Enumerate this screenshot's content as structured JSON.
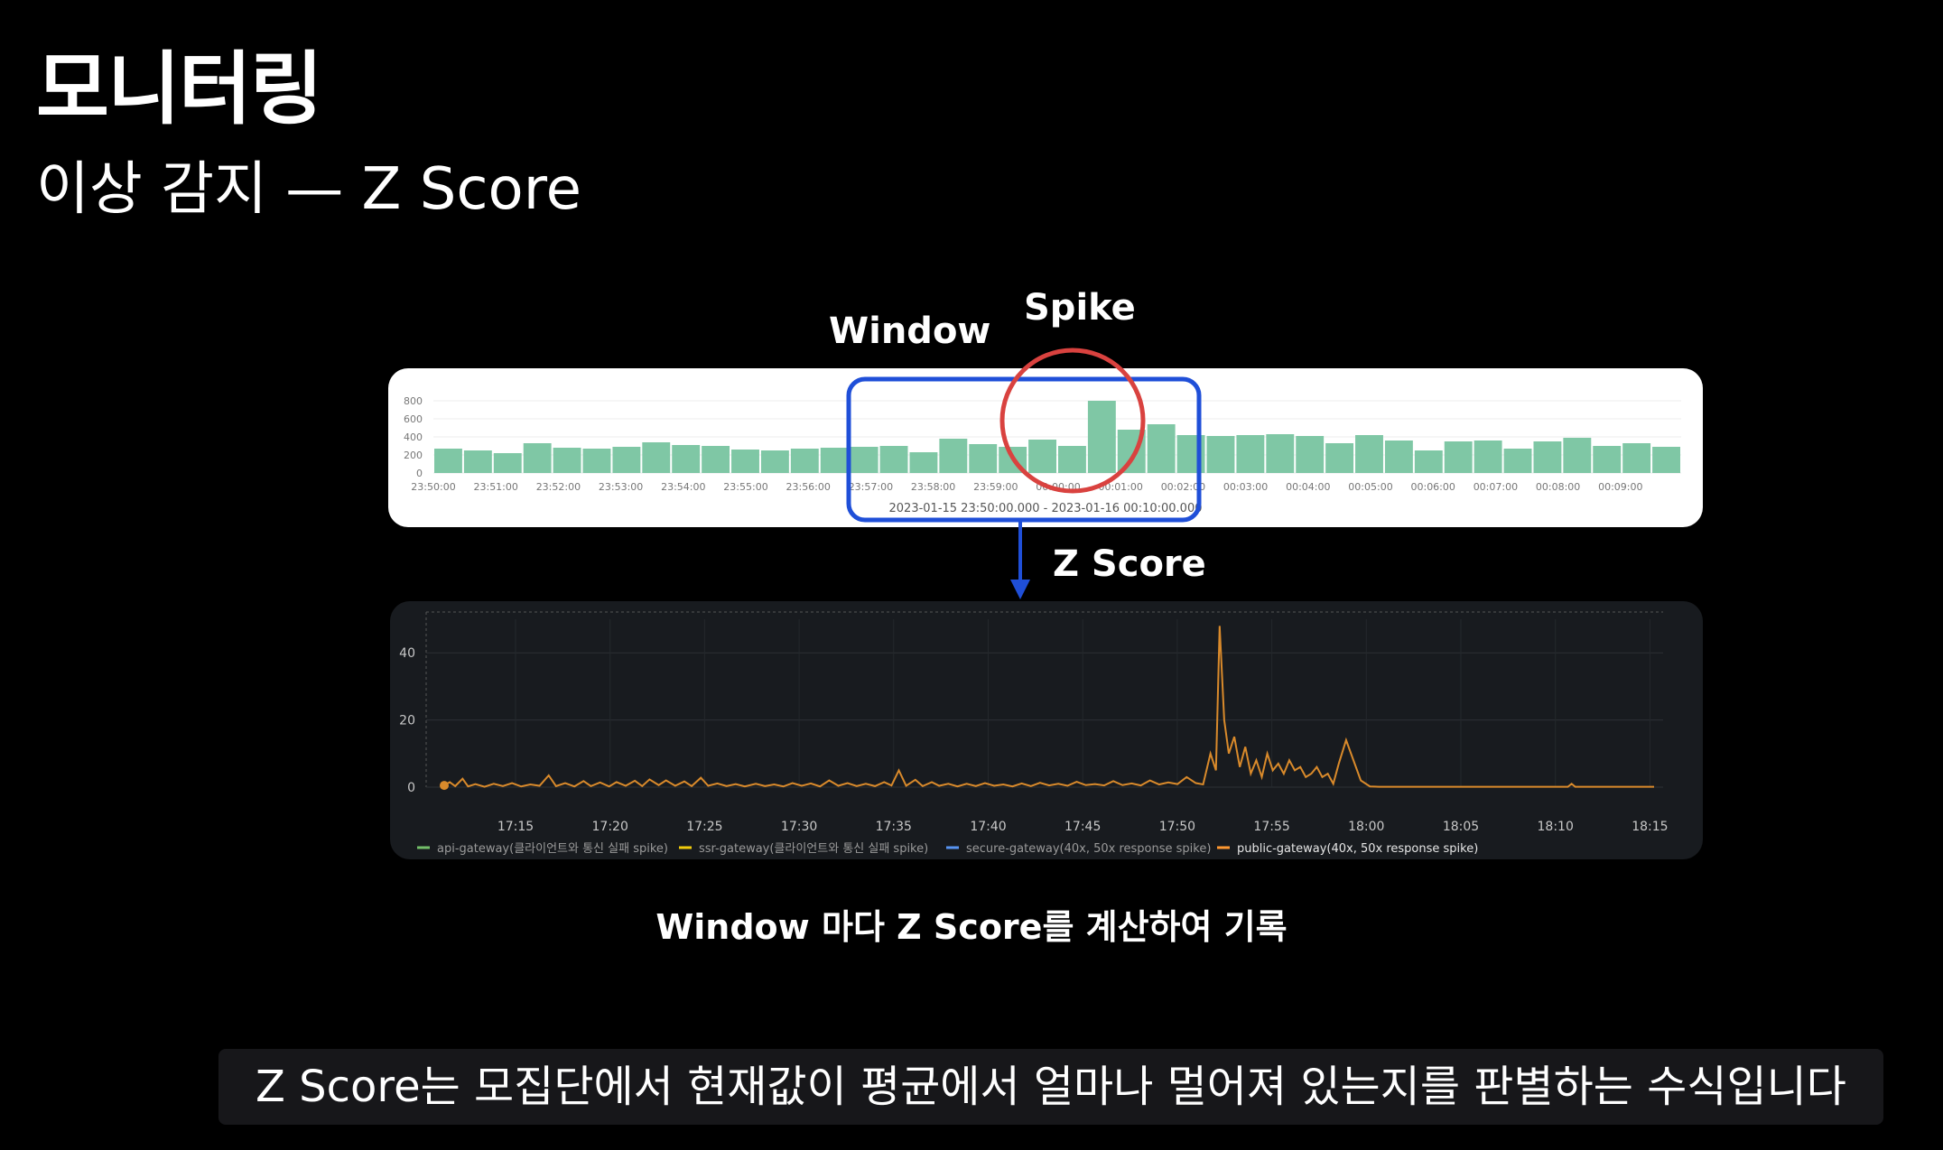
{
  "slide": {
    "title": "모니터링",
    "subtitle": "이상 감지 — Z Score",
    "labels": {
      "window": "Window",
      "spike": "Spike",
      "zscore": "Z Score"
    },
    "caption": "Window 마다 Z Score를 계산하여 기록",
    "subtitle_bar": "Z Score는 모집단에서 현재값이 평균에서 얼마나 멀어져 있는지를 판별하는 수식입니다"
  },
  "colors": {
    "bar": "#7fc7a5",
    "window_box": "#1f4fd8",
    "spike_circle": "#d9423f",
    "z_line": "#d98a2b",
    "legend": [
      "#73bf69",
      "#f2cc0c",
      "#5794f2",
      "#ff9830"
    ]
  },
  "chart_data": [
    {
      "type": "bar",
      "yticks": [
        "800",
        "600",
        "400",
        "200",
        "0"
      ],
      "ylim": [
        0,
        800
      ],
      "xticks": [
        "23:50:00",
        "23:51:00",
        "23:52:00",
        "23:53:00",
        "23:54:00",
        "23:55:00",
        "23:56:00",
        "23:57:00",
        "23:58:00",
        "23:59:00",
        "00:00:00",
        "00:01:00",
        "00:02:00",
        "00:03:00",
        "00:04:00",
        "00:05:00",
        "00:06:00",
        "00:07:00",
        "00:08:00",
        "00:09:00"
      ],
      "values": [
        270,
        250,
        220,
        330,
        280,
        270,
        290,
        340,
        310,
        300,
        260,
        250,
        270,
        280,
        290,
        300,
        230,
        380,
        320,
        290,
        370,
        300,
        800,
        480,
        540,
        420,
        410,
        420,
        430,
        410,
        330,
        420,
        360,
        250,
        350,
        360,
        270,
        350,
        390,
        300,
        330,
        290
      ],
      "xlabel": "2023-01-15 23:50:00.000 - 2023-01-16 00:10:00.000",
      "window_range": [
        14,
        25
      ],
      "spike_index": 22
    },
    {
      "type": "line",
      "yticks": [
        "40",
        "20",
        "0"
      ],
      "ylim": [
        0,
        50
      ],
      "xticks": [
        "17:15",
        "17:20",
        "17:25",
        "17:30",
        "17:35",
        "17:40",
        "17:45",
        "17:50",
        "17:55",
        "18:00",
        "18:05",
        "18:10",
        "18:15"
      ],
      "xlim_minutes": [
        0,
        66
      ],
      "series": [
        {
          "name": "public-gateway(40x, 50x response spike)",
          "points": [
            [
              0,
              0.5
            ],
            [
              0.3,
              1.5
            ],
            [
              0.6,
              0.3
            ],
            [
              1,
              2.5
            ],
            [
              1.3,
              0.2
            ],
            [
              1.7,
              0.9
            ],
            [
              2.2,
              0.1
            ],
            [
              2.7,
              1
            ],
            [
              3.2,
              0.3
            ],
            [
              3.7,
              1.2
            ],
            [
              4.2,
              0.2
            ],
            [
              4.7,
              0.8
            ],
            [
              5.2,
              0.4
            ],
            [
              5.7,
              3.5
            ],
            [
              6.1,
              0.3
            ],
            [
              6.6,
              1.2
            ],
            [
              7.1,
              0.2
            ],
            [
              7.6,
              1.8
            ],
            [
              8,
              0.3
            ],
            [
              8.5,
              1.4
            ],
            [
              9,
              0.2
            ],
            [
              9.4,
              1.5
            ],
            [
              9.9,
              0.4
            ],
            [
              10.4,
              1.9
            ],
            [
              10.8,
              0.3
            ],
            [
              11.2,
              2.3
            ],
            [
              11.7,
              0.6
            ],
            [
              12.1,
              2
            ],
            [
              12.6,
              0.4
            ],
            [
              13.1,
              1.7
            ],
            [
              13.5,
              0.3
            ],
            [
              14,
              2.8
            ],
            [
              14.4,
              0.4
            ],
            [
              14.9,
              1.1
            ],
            [
              15.4,
              0.3
            ],
            [
              15.9,
              0.9
            ],
            [
              16.4,
              0.2
            ],
            [
              17,
              1
            ],
            [
              17.5,
              0.3
            ],
            [
              18,
              0.8
            ],
            [
              18.5,
              0.2
            ],
            [
              19,
              1.2
            ],
            [
              19.5,
              0.4
            ],
            [
              20,
              1.1
            ],
            [
              20.5,
              0.2
            ],
            [
              21,
              2
            ],
            [
              21.5,
              0.4
            ],
            [
              22,
              1.2
            ],
            [
              22.5,
              0.3
            ],
            [
              23,
              1
            ],
            [
              23.5,
              0.3
            ],
            [
              24,
              1.5
            ],
            [
              24.4,
              0.5
            ],
            [
              24.8,
              5
            ],
            [
              25.2,
              0.4
            ],
            [
              25.7,
              2.2
            ],
            [
              26.1,
              0.3
            ],
            [
              26.6,
              1.5
            ],
            [
              27,
              0.4
            ],
            [
              27.5,
              1
            ],
            [
              28,
              0.2
            ],
            [
              28.5,
              1
            ],
            [
              29,
              0.3
            ],
            [
              29.5,
              1.2
            ],
            [
              30,
              0.4
            ],
            [
              30.5,
              0.8
            ],
            [
              31,
              0.2
            ],
            [
              31.5,
              1.1
            ],
            [
              32,
              0.3
            ],
            [
              32.5,
              1.3
            ],
            [
              33,
              0.5
            ],
            [
              33.5,
              1
            ],
            [
              34,
              0.4
            ],
            [
              34.5,
              1.6
            ],
            [
              35,
              0.6
            ],
            [
              35.5,
              0.9
            ],
            [
              36,
              0.5
            ],
            [
              36.5,
              1.8
            ],
            [
              37,
              0.6
            ],
            [
              37.5,
              1.1
            ],
            [
              38,
              0.5
            ],
            [
              38.5,
              2
            ],
            [
              39,
              0.8
            ],
            [
              39.5,
              1.4
            ],
            [
              40,
              0.9
            ],
            [
              40.5,
              3
            ],
            [
              41,
              1.2
            ],
            [
              41.4,
              0.8
            ],
            [
              41.8,
              10
            ],
            [
              42.1,
              5
            ],
            [
              42.3,
              48
            ],
            [
              42.55,
              20
            ],
            [
              42.8,
              10
            ],
            [
              43.1,
              15
            ],
            [
              43.4,
              6
            ],
            [
              43.7,
              12
            ],
            [
              44,
              4
            ],
            [
              44.3,
              8
            ],
            [
              44.6,
              3
            ],
            [
              44.9,
              10
            ],
            [
              45.2,
              5
            ],
            [
              45.5,
              7
            ],
            [
              45.8,
              4
            ],
            [
              46.1,
              8
            ],
            [
              46.4,
              5
            ],
            [
              46.7,
              6
            ],
            [
              47,
              3
            ],
            [
              47.3,
              4
            ],
            [
              47.6,
              6
            ],
            [
              47.9,
              3
            ],
            [
              48.2,
              4
            ],
            [
              48.5,
              1
            ],
            [
              48.8,
              7
            ],
            [
              49.2,
              14
            ],
            [
              49.6,
              8
            ],
            [
              50,
              2
            ],
            [
              50.5,
              0.2
            ],
            [
              51,
              0.1
            ],
            [
              56,
              0.1
            ],
            [
              60,
              0.1
            ],
            [
              61.3,
              0.1
            ],
            [
              61.5,
              1
            ],
            [
              61.7,
              0.1
            ],
            [
              66,
              0.1
            ]
          ]
        }
      ],
      "legend": [
        "api-gateway(클라이언트와 통신 실패 spike)",
        "ssr-gateway(클라이언트와 통신 실패 spike)",
        "secure-gateway(40x, 50x response spike)",
        "public-gateway(40x, 50x response spike)"
      ]
    }
  ]
}
